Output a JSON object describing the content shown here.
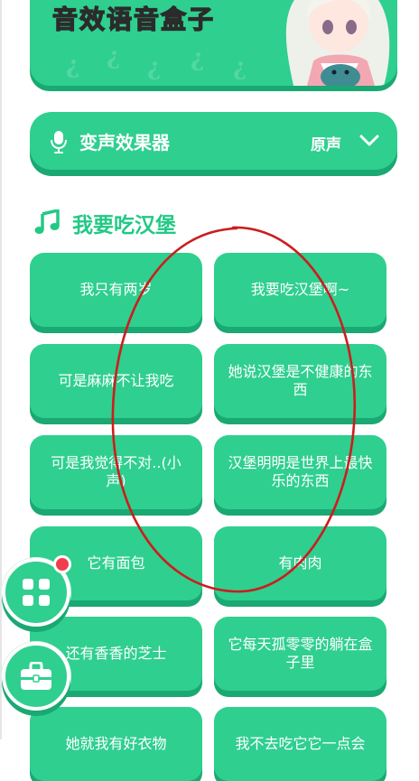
{
  "banner": {
    "title": "音效语音盒子"
  },
  "effect_bar": {
    "label": "变声效果器",
    "value": "原声",
    "icons": [
      "microphone-icon",
      "chevron-down-icon"
    ]
  },
  "section": {
    "title": "我要吃汉堡",
    "icon": "music-note-icon"
  },
  "buttons": [
    "我只有两岁",
    "我要吃汉堡啊~",
    "可是麻麻不让我吃",
    "她说汉堡是不健康的东西",
    "可是我觉得不对..(小声)",
    "汉堡明明是世界上最快乐的东西",
    "它有面包",
    "有肉肉",
    "还有香香的芝士",
    "它每天孤零零的躺在盒子里",
    "她就我有好衣物",
    "我不去吃它它一点会"
  ],
  "fabs": [
    {
      "icon": "grid-icon",
      "has_badge": true
    },
    {
      "icon": "toolbox-icon",
      "has_badge": false
    }
  ],
  "colors": {
    "primary": "#2fcf8f",
    "shadow": "#1aa873",
    "heading": "#22c985",
    "badge": "#f23d4f",
    "annotation": "#cc1d1d"
  }
}
